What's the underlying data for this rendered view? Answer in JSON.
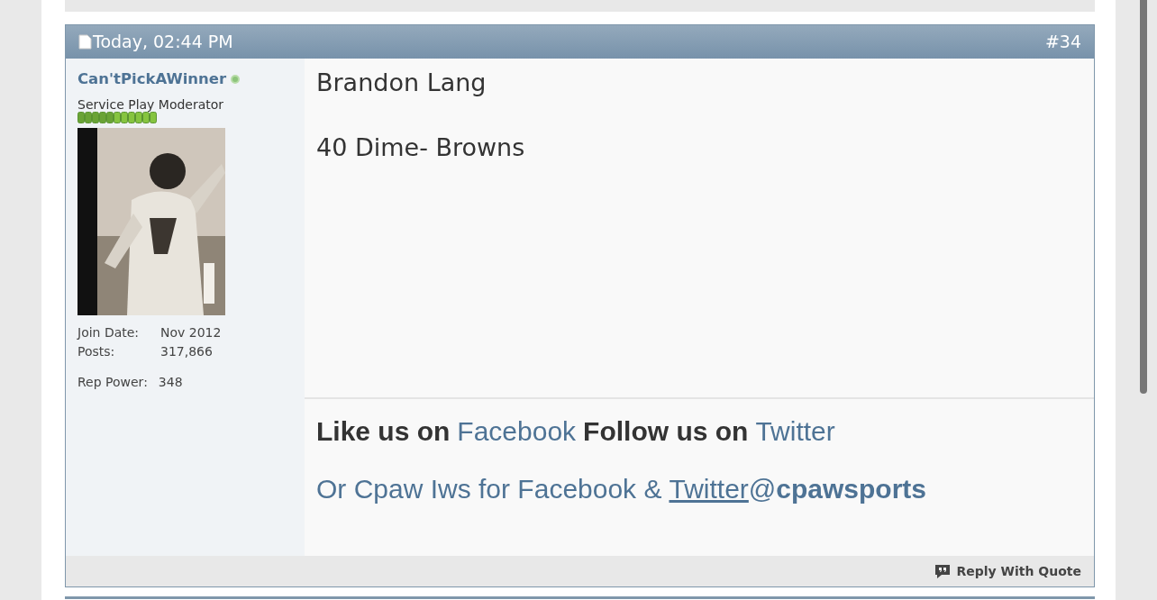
{
  "post": {
    "date": "Today, 02:44 PM",
    "number": "#34",
    "user": {
      "name": "Can'tPickAWinner",
      "online": true,
      "title": "Service Play Moderator",
      "details": [
        {
          "label": "Join Date:",
          "value": "Nov 2012"
        },
        {
          "label": "Posts:",
          "value": "317,866"
        }
      ],
      "rep": {
        "label": "Rep Power:",
        "value": "348"
      }
    },
    "body": [
      "Brandon Lang",
      "40 Dime- Browns"
    ],
    "signature": [
      [
        {
          "text": "Like us on",
          "kind": "bold"
        },
        {
          "text": "Facebook",
          "kind": "link"
        },
        {
          "text": "Follow us on",
          "kind": "bold"
        },
        {
          "text": "Twitter",
          "kind": "link"
        }
      ],
      [
        {
          "text": "Or Cpaw Iws for Facebook &",
          "kind": "plain"
        },
        {
          "text": "Twitter",
          "kind": "underlined_link"
        },
        {
          "text": "@",
          "kind": "plain"
        },
        {
          "text": "cpawsports",
          "kind": "bold"
        }
      ]
    ],
    "reply_button": "Reply With Quote"
  }
}
